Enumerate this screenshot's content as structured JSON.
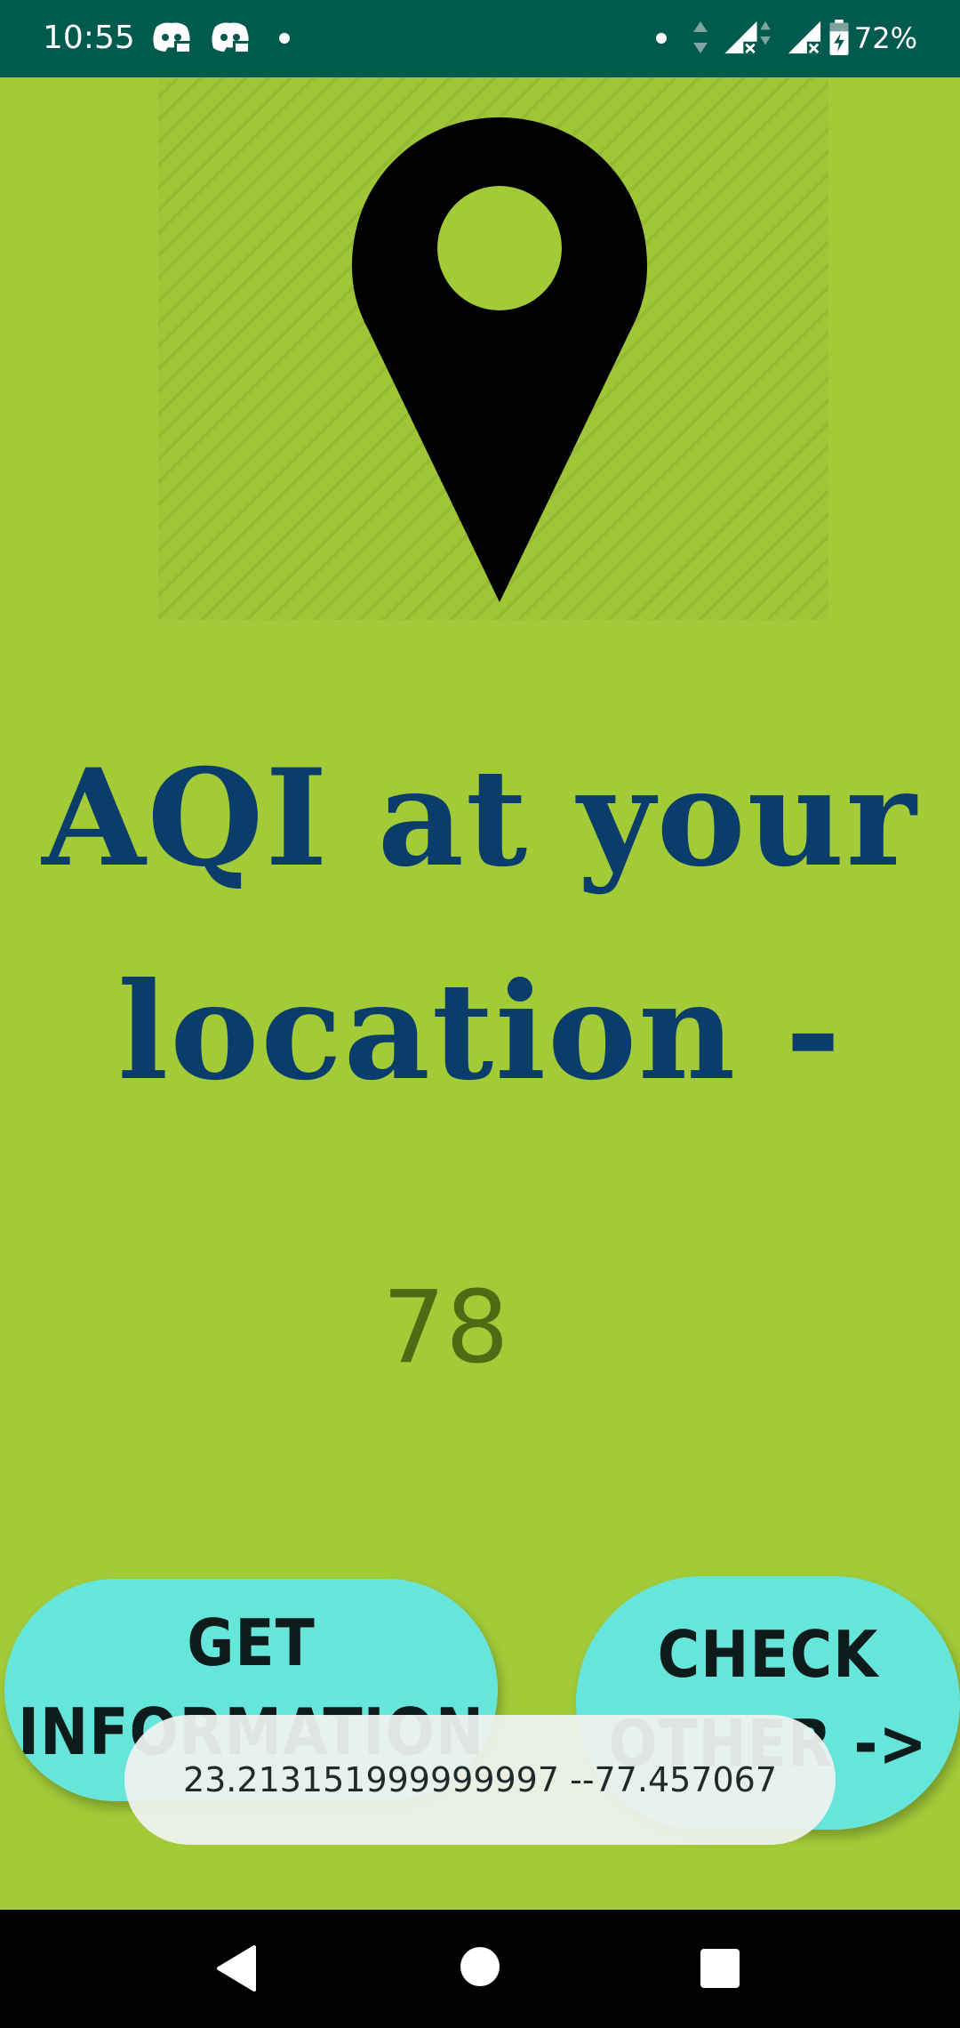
{
  "status_bar": {
    "time": "10:55",
    "battery": "72%",
    "icons": [
      "discord-icon",
      "discord-icon",
      "notification-dot",
      "dot",
      "data-arrows-icon",
      "signal-no-service-icon",
      "signal-no-service-icon",
      "battery-charging-icon"
    ]
  },
  "hero": {
    "icon": "location-pin-icon"
  },
  "heading": {
    "line1": "AQI at your",
    "line2": "location -"
  },
  "aqi": {
    "value": "78"
  },
  "buttons": {
    "get_info_line1": "GET",
    "get_info_line2": "INFORMATION",
    "check_line1": "CHECK",
    "check_line2": "OTHER ->"
  },
  "toast": {
    "text": "23.213151999999997 --77.457067"
  },
  "nav_bar": {
    "icons": [
      "back-icon",
      "home-icon",
      "recents-icon"
    ]
  },
  "colors": {
    "background": "#a3cb38",
    "status_bar": "#005a4e",
    "heading": "#0b3d6b",
    "aqi_value": "#4c6b12",
    "button": "#66e6da"
  }
}
